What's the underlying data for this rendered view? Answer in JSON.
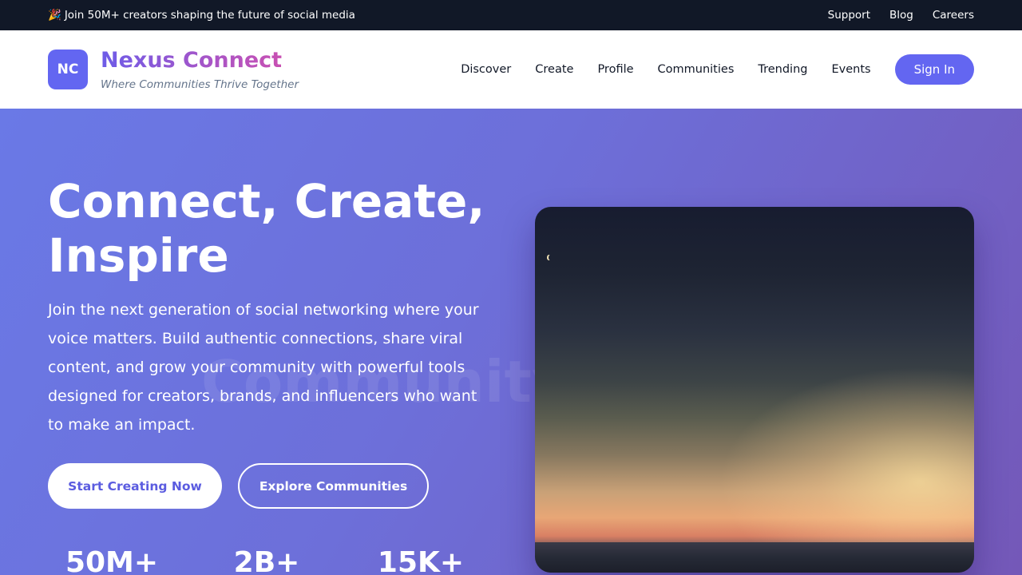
{
  "topbar": {
    "announcement_icon": "🎉",
    "announcement": "Join 50M+ creators shaping the future of social media",
    "links": [
      "Support",
      "Blog",
      "Careers"
    ]
  },
  "header": {
    "logo_text": "NC",
    "brand_name": "Nexus Connect",
    "tagline": "Where Communities Thrive Together",
    "nav": [
      "Discover",
      "Create",
      "Profile",
      "Communities",
      "Trending",
      "Events"
    ],
    "sign_in_label": "Sign In"
  },
  "hero": {
    "title": "Connect, Create, Inspire",
    "description": "Join the next generation of social networking where your voice matters. Build authentic connections, share viral content, and grow your community with powerful tools designed for creators, brands, and influencers who want to make an impact.",
    "watermark": "Community",
    "primary_button": "Start Creating Now",
    "secondary_button": "Explore Communities",
    "stats": [
      "50M+",
      "2B+",
      "15K+"
    ]
  },
  "colors": {
    "accent": "#6366f1",
    "topbar_bg": "#111827",
    "hero_gradient_start": "#6a79e6",
    "hero_gradient_end": "#7458b8"
  }
}
